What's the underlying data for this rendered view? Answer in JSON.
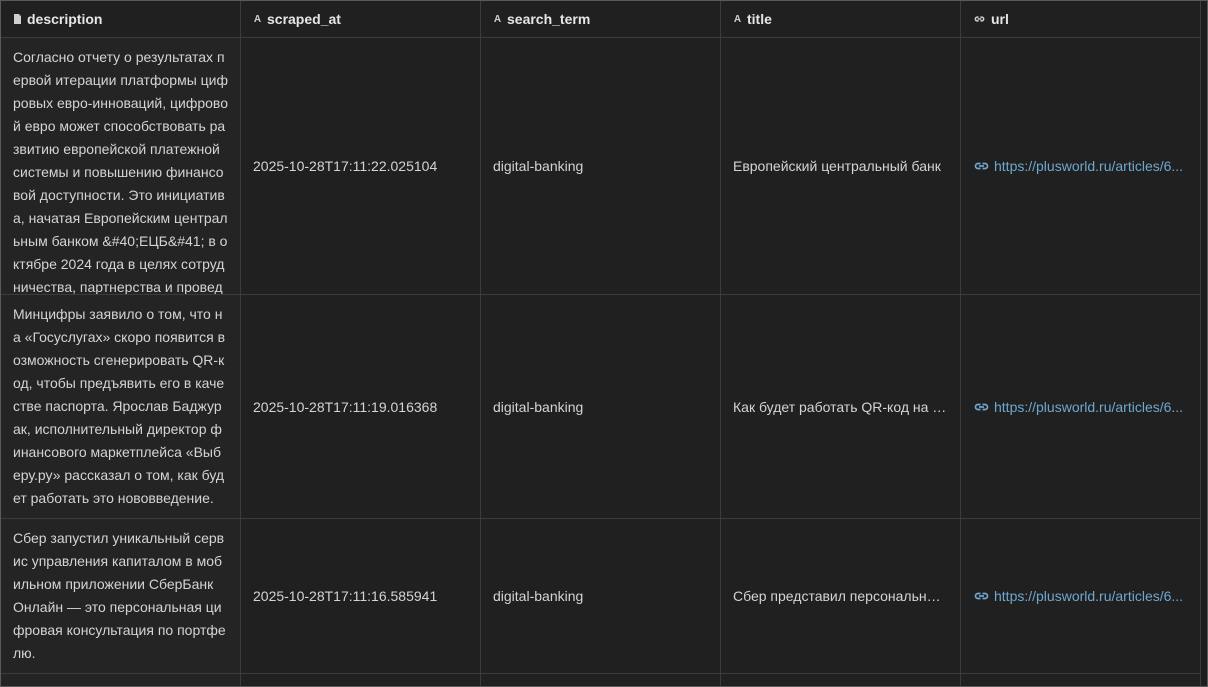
{
  "columns": [
    {
      "name": "description",
      "icon": "document-icon"
    },
    {
      "name": "scraped_at",
      "icon": "text-type-icon"
    },
    {
      "name": "search_term",
      "icon": "text-type-icon"
    },
    {
      "name": "title",
      "icon": "text-type-icon"
    },
    {
      "name": "url",
      "icon": "link-icon"
    }
  ],
  "rows": [
    {
      "description": "Согласно отчету о результатах первой итерации платформы цифровых евро-инноваций, цифровой евро может способствовать развитию европейской платежной системы и повышению финансовой доступности. Это инициатива, начатая Европейским центральным банком &#40;ЕЦБ&#41; в октябре 2024 года в целях сотрудничества, партнерства и провед",
      "scraped_at": "2025-10-28T17:11:22.025104",
      "search_term": "digital-banking",
      "title": "Европейский центральный банк",
      "url": "https://plusworld.ru/articles/6..."
    },
    {
      "description": "Минцифры заявило о том, что на «Госуслугах» скоро появится возможность сгенерировать QR-код, чтобы предъявить его в качестве паспорта. Ярослав Баджурак, исполнительный директор финансового маркетплейса «Выберу.ру» рассказал о том, как будет работать это нововведение.",
      "scraped_at": "2025-10-28T17:11:19.016368",
      "search_term": "digital-banking",
      "title": "Как будет работать QR-код на «Госуслугах»",
      "url": "https://plusworld.ru/articles/6..."
    },
    {
      "description": "Сбер запустил уникальный сервис управления капиталом в мобильном приложении СберБанк Онлайн — это персональная цифровая консультация по портфелю.",
      "scraped_at": "2025-10-28T17:11:16.585941",
      "search_term": "digital-banking",
      "title": "Сбер представил персональный сервис",
      "url": "https://plusworld.ru/articles/6..."
    }
  ]
}
